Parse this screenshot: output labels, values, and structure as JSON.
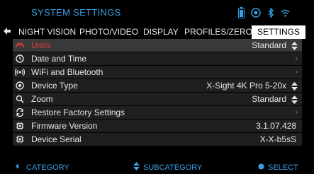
{
  "header": {
    "title": "SYSTEM SETTINGS"
  },
  "status_icons": [
    "battery-icon",
    "camera-icon",
    "bluetooth-icon",
    "wifi-icon"
  ],
  "tabs": [
    {
      "label": "NIGHT VISION"
    },
    {
      "label": "PHOTO/VIDEO"
    },
    {
      "label": "DISPLAY"
    },
    {
      "label": "PROFILES/ZERO"
    },
    {
      "label": "SETTINGS",
      "active": true
    }
  ],
  "rows": [
    {
      "icon": "units-icon",
      "label": "Units",
      "value": "Standard",
      "control": "updown",
      "highlighted": true
    },
    {
      "icon": "clock-icon",
      "label": "Date and Time",
      "value": "",
      "control": "chevron"
    },
    {
      "icon": "wifi-broadcast-icon",
      "label": "WiFi and Bluetooth",
      "value": "",
      "control": "chevron"
    },
    {
      "icon": "target-icon",
      "label": "Device Type",
      "value": "X-Sight 4K Pro 5-20x",
      "control": "updown"
    },
    {
      "icon": "magnifier-icon",
      "label": "Zoom",
      "value": "Standard",
      "control": "updown"
    },
    {
      "icon": "restore-icon",
      "label": "Restore Factory Settings",
      "value": "",
      "control": "chevron"
    },
    {
      "icon": "chip-icon",
      "label": "Firmware Version",
      "value": "3.1.07.428",
      "control": "none"
    },
    {
      "icon": "chip-icon",
      "label": "Device Serial",
      "value": "X-X-b5sS",
      "control": "none"
    }
  ],
  "footer": {
    "category": "CATEGORY",
    "subcategory": "SUBCATEGORY",
    "select": "SELECT"
  },
  "colors": {
    "accent": "#3aa0e8",
    "highlight_text": "#e23a3a",
    "row_bg": "#1f1f1f",
    "row_highlight_bg": "#3a3a3a"
  }
}
